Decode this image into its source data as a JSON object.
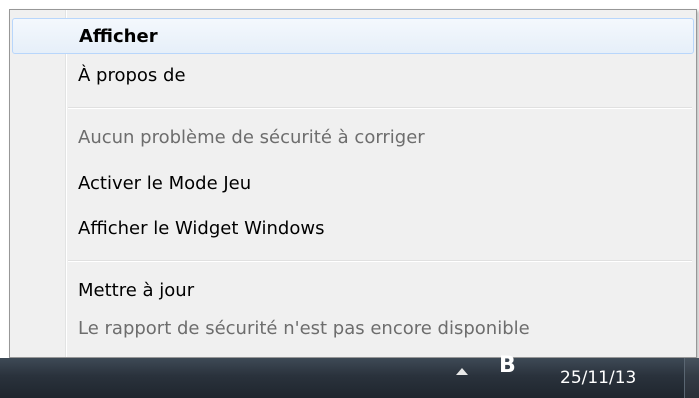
{
  "menu": {
    "items": [
      {
        "label": "Afficher",
        "default": true,
        "enabled": true
      },
      {
        "label": "À propos de",
        "default": false,
        "enabled": true
      },
      {
        "label": "Aucun problème de sécurité à corriger",
        "default": false,
        "enabled": false
      },
      {
        "label": "Activer le Mode Jeu",
        "default": false,
        "enabled": true
      },
      {
        "label": "Afficher le Widget Windows",
        "default": false,
        "enabled": true
      },
      {
        "label": "Mettre à jour",
        "default": false,
        "enabled": true
      },
      {
        "label": "Le rapport de sécurité n'est pas encore disponible",
        "default": false,
        "enabled": false
      }
    ]
  },
  "taskbar": {
    "tray_icon_letter": "B",
    "tray_arrow_icon": "chevron-up-icon",
    "clock_date": "25/11/13"
  },
  "colors": {
    "menu_background": "#f0f0f0",
    "highlight_border": "#b8d6fb",
    "disabled_text": "#6d6d6d",
    "taskbar": "#2a323c"
  }
}
